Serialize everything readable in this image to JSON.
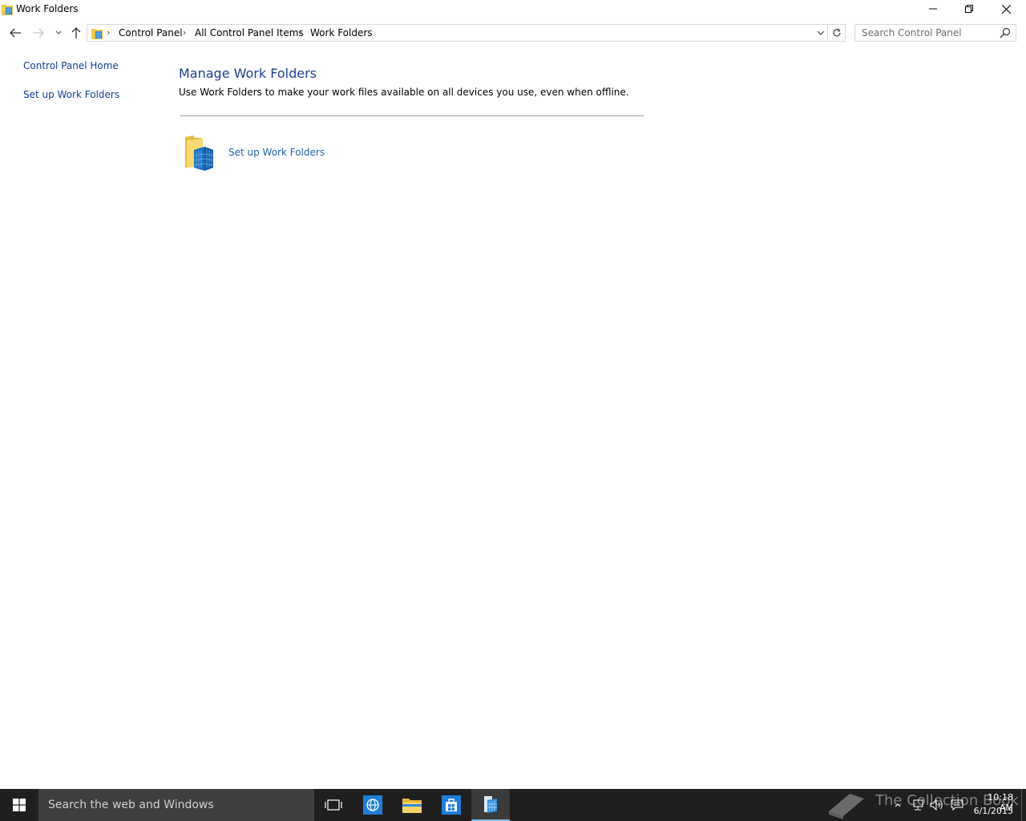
{
  "window": {
    "title": "Work Folders"
  },
  "navigation": {
    "breadcrumbs": [
      "Control Panel",
      "All Control Panel Items",
      "Work Folders"
    ],
    "search_placeholder": "Search Control Panel"
  },
  "left_pane": {
    "home_link": "Control Panel Home",
    "setup_link": "Set up Work Folders"
  },
  "main": {
    "title": "Manage Work Folders",
    "description": "Use Work Folders to make your work files available on all devices you use, even when offline.",
    "setup_link": "Set up Work Folders"
  },
  "taskbar": {
    "search_text": "Search the web and Windows",
    "pinned": [
      "task-view-icon",
      "internet-explorer-icon",
      "file-explorer-icon",
      "store-icon",
      "work-folders-icon"
    ],
    "watermark": "The Collection Book",
    "clock_time": "10:18 AM",
    "clock_date": "6/1/2015"
  },
  "colors": {
    "link": "#1e63b5",
    "heading": "#1c3f94",
    "taskbar": "#1f1f1f",
    "accent": "#76b9ed"
  }
}
